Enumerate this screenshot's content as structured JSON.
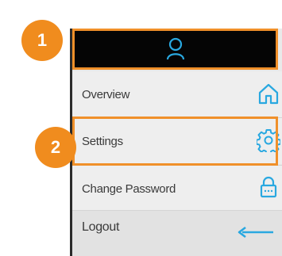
{
  "annotations": {
    "badge_1": "1",
    "badge_2": "2"
  },
  "menu": {
    "header_icon": "user-icon",
    "items": [
      {
        "label": "Overview",
        "icon": "home-icon"
      },
      {
        "label": "Settings",
        "icon": "gear-icon"
      },
      {
        "label": "Change Password",
        "icon": "lock-icon"
      },
      {
        "label": "Logout",
        "icon": "arrow-left-icon"
      }
    ]
  },
  "colors": {
    "accent": "#f0902a",
    "icon": "#29a8e0",
    "header_bg": "#050505",
    "menu_bg": "#eeeeee"
  }
}
